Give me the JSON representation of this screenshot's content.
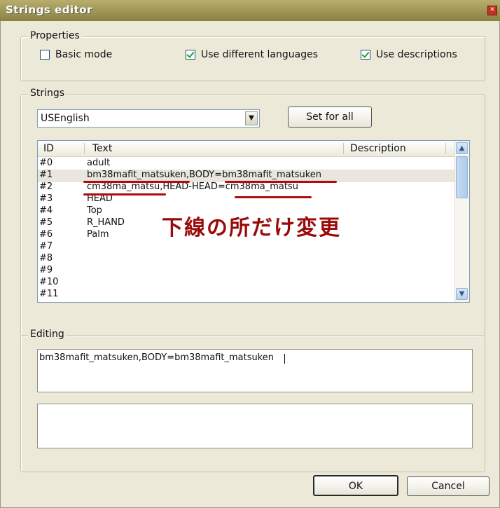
{
  "window": {
    "title": "Strings editor"
  },
  "properties": {
    "legend": "Properties",
    "basic_mode": {
      "label": "Basic mode",
      "checked": false
    },
    "use_languages": {
      "label": "Use different languages",
      "checked": true
    },
    "use_descriptions": {
      "label": "Use descriptions",
      "checked": true
    }
  },
  "strings": {
    "legend": "Strings",
    "language": "USEnglish",
    "set_for_all": "Set for all",
    "columns": {
      "id": "ID",
      "text": "Text",
      "description": "Description"
    },
    "rows": [
      {
        "id": "#0",
        "text": "adult"
      },
      {
        "id": "#1",
        "text": "bm38mafit_matsuken,BODY=bm38mafit_matsuken"
      },
      {
        "id": "#2",
        "text": "cm38ma_matsu,HEAD-HEAD=cm38ma_matsu"
      },
      {
        "id": "#3",
        "text": "HEAD"
      },
      {
        "id": "#4",
        "text": "Top"
      },
      {
        "id": "#5",
        "text": "R_HAND"
      },
      {
        "id": "#6",
        "text": "Palm"
      },
      {
        "id": "#7",
        "text": ""
      },
      {
        "id": "#8",
        "text": ""
      },
      {
        "id": "#9",
        "text": ""
      },
      {
        "id": "#10",
        "text": ""
      },
      {
        "id": "#11",
        "text": ""
      }
    ],
    "annotation": "下線の所だけ変更"
  },
  "editing": {
    "legend": "Editing",
    "text": "bm38mafit_matsuken,BODY=bm38mafit_matsuken",
    "description": ""
  },
  "buttons": {
    "ok": "OK",
    "cancel": "Cancel"
  },
  "colors": {
    "annotation_red": "#b00c0c",
    "title_bar": "#9d9352"
  }
}
